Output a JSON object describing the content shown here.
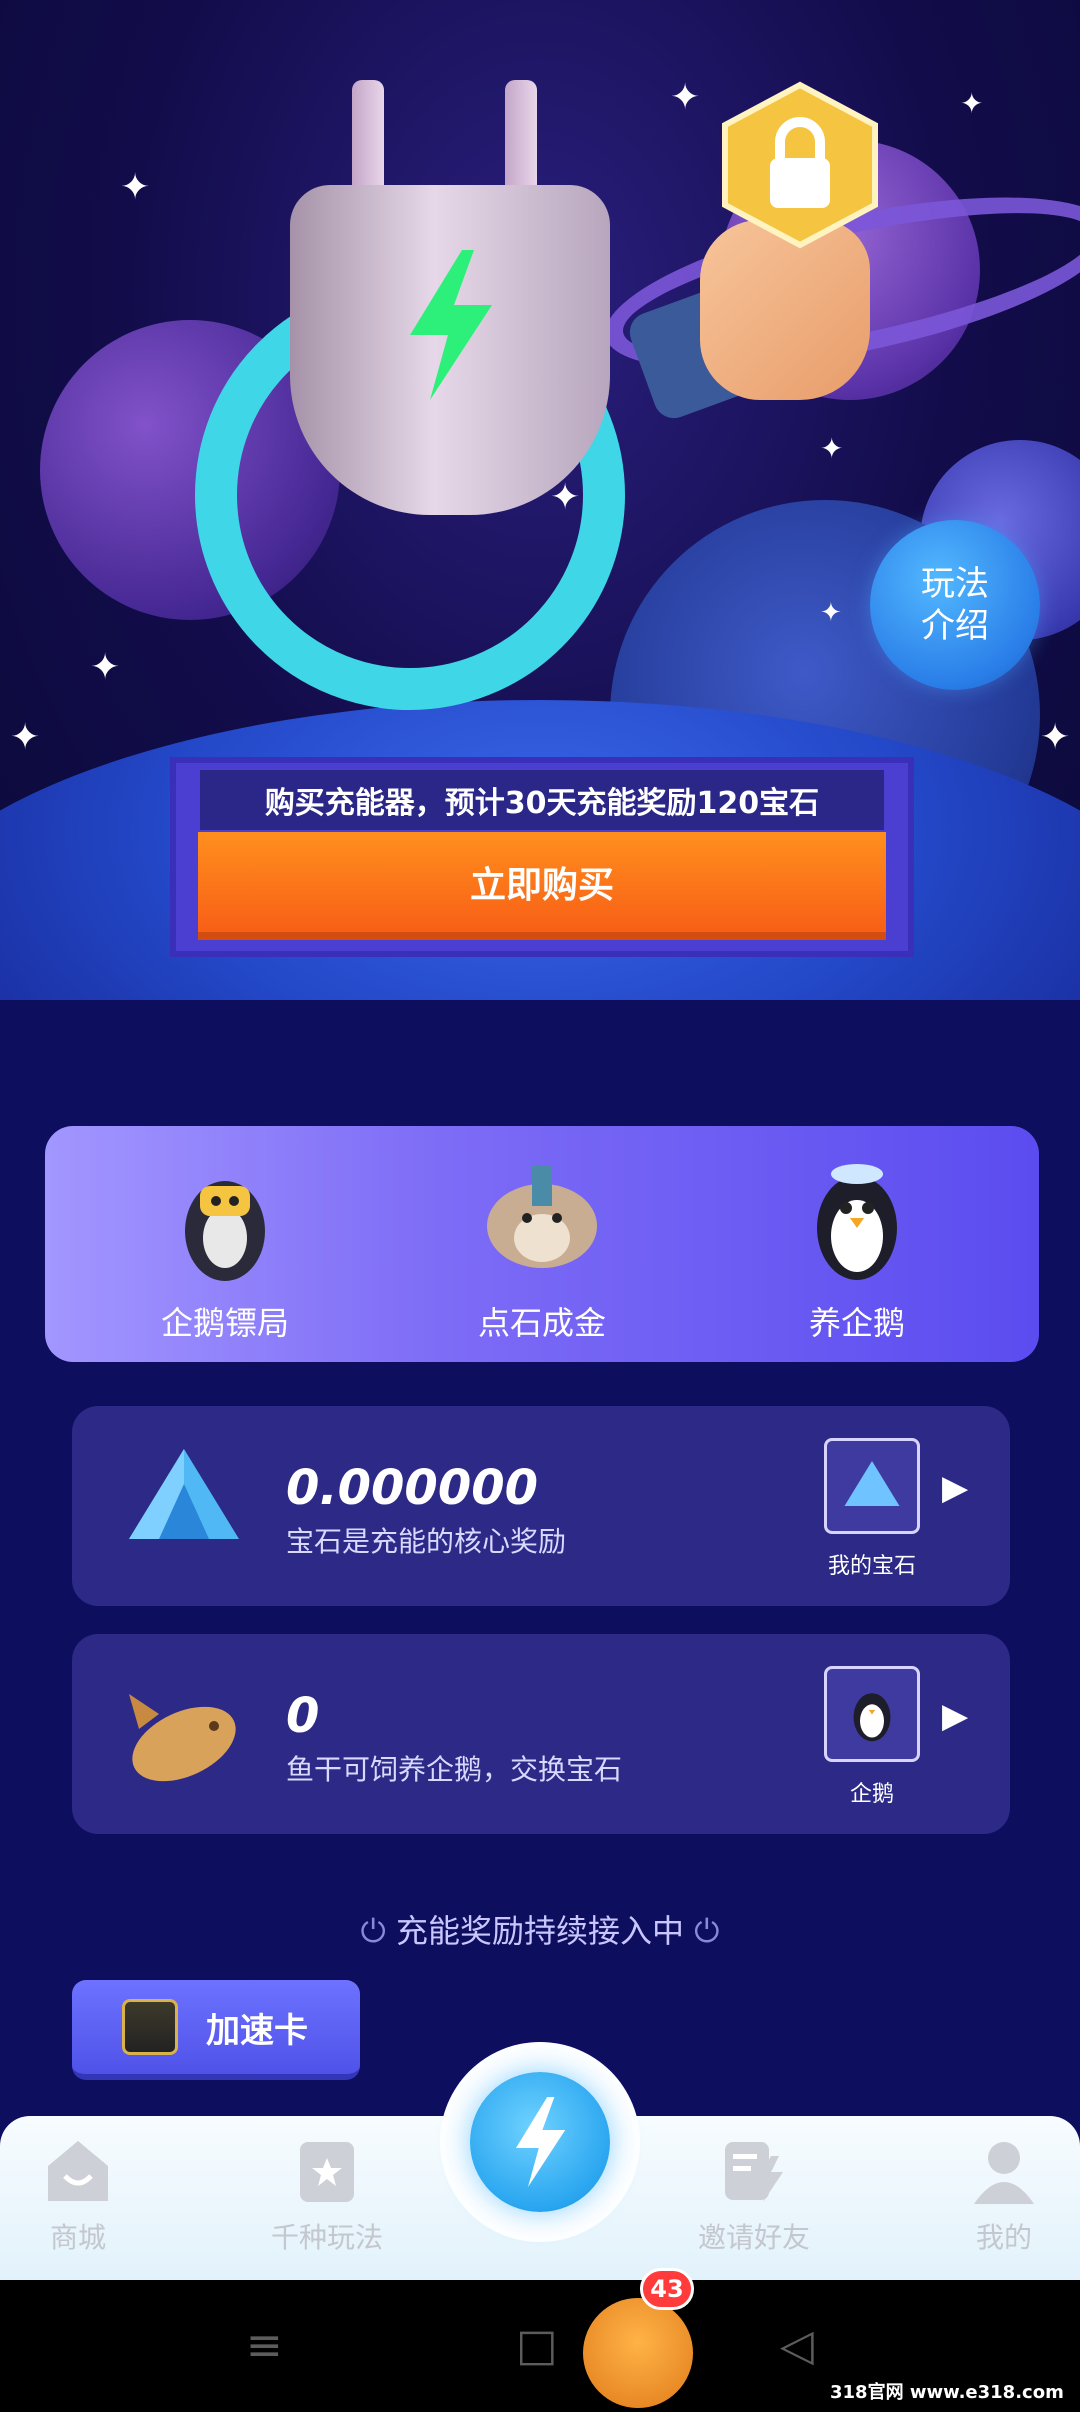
{
  "hero": {
    "help_button": "玩法\n介绍",
    "promo_text": "购买充能器，预计30天充能奖励120宝石",
    "buy_button": "立即购买"
  },
  "features": [
    {
      "label": "企鹅镖局",
      "icon": "penguin-escort-icon"
    },
    {
      "label": "点石成金",
      "icon": "monkey-king-icon"
    },
    {
      "label": "养企鹅",
      "icon": "penguin-raise-icon"
    }
  ],
  "gem_card": {
    "value": "0.000000",
    "desc": "宝石是充能的核心奖励",
    "thumb_label": "我的宝石"
  },
  "fish_card": {
    "value": "0",
    "desc": "鱼干可饲养企鹅，交换宝石",
    "thumb_label": "企鹅"
  },
  "status_text": "充能奖励持续接入中",
  "speed_card": {
    "label": "加速卡"
  },
  "nav": {
    "items": [
      {
        "label": "商城",
        "icon": "shop-icon"
      },
      {
        "label": "千种玩法",
        "icon": "games-icon"
      },
      {
        "label": "邀请好友",
        "icon": "invite-icon"
      },
      {
        "label": "我的",
        "icon": "profile-icon"
      }
    ]
  },
  "notification_badge": "43",
  "watermark": "318官网 www.e318.com",
  "colors": {
    "accent_orange": "#f85f16",
    "feature_purple": "#7d6cf6",
    "card_bg": "#2c2a86",
    "page_bg": "#0e0e5e"
  }
}
